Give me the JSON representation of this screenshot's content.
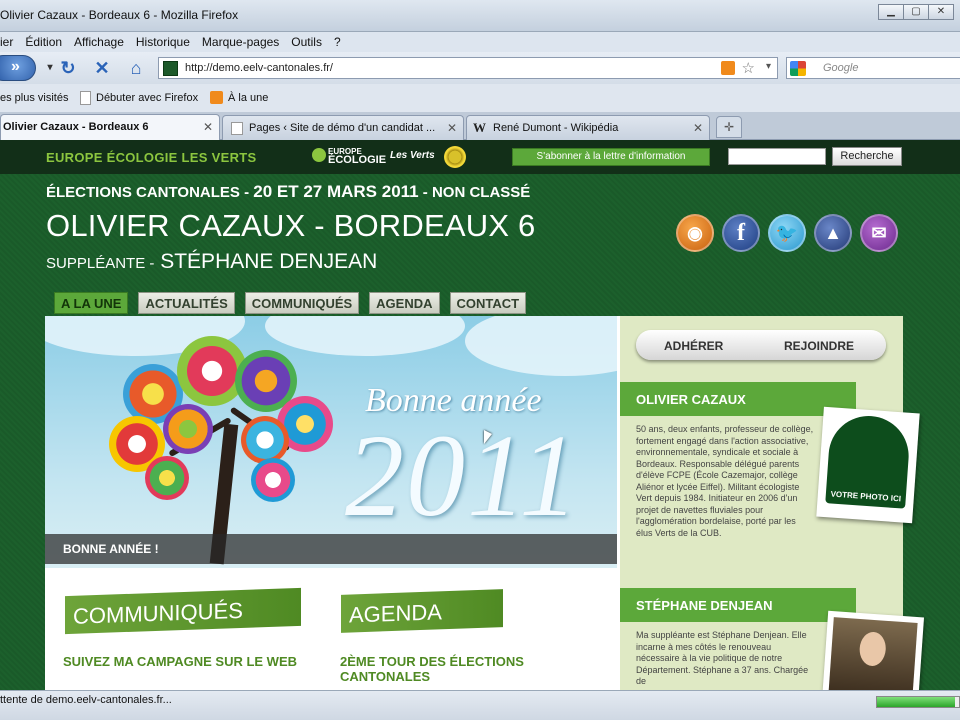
{
  "window": {
    "title": "Olivier Cazaux - Bordeaux 6 - Mozilla Firefox"
  },
  "menu": [
    "ier",
    "Édition",
    "Affichage",
    "Historique",
    "Marque-pages",
    "Outils",
    "?"
  ],
  "nav": {
    "url": "http://demo.eelv-cantonales.fr/",
    "search_placeholder": "Google"
  },
  "bookmarks": [
    "es plus visités",
    "Débuter avec Firefox",
    "À la une"
  ],
  "tabs": [
    {
      "label": "Olivier Cazaux - Bordeaux 6",
      "active": true
    },
    {
      "label": "Pages ‹ Site de démo d'un candidat ...",
      "active": false
    },
    {
      "label": "René Dumont - Wikipédia",
      "active": false
    }
  ],
  "site": {
    "brand": "EUROPE ÉCOLOGIE LES VERTS",
    "logo_ee": [
      "EUROPE",
      "ÉCOLOGIE"
    ],
    "logo_verts": "Les Verts",
    "subscribe": "S'abonner à la lettre d'information",
    "search_button": "Recherche",
    "election_prefix": "ÉLECTIONS CANTONALES -",
    "election_dates": "20 ET 27 MARS 2011",
    "election_suffix": "- NON CLASSÉ",
    "candidate": "OLIVIER CAZAUX - BORDEAUX 6",
    "substitute_prefix": "SUPPLÉANTE -",
    "substitute_name": "STÉPHANE DENJEAN",
    "menu": [
      "A LA UNE",
      "ACTUALITÉS",
      "COMMUNIQUÉS",
      "AGENDA",
      "CONTACT"
    ],
    "hero": {
      "greeting": "Bonne année",
      "year": "2011",
      "caption": "BONNE ANNÉE !"
    },
    "columns": [
      {
        "title": "COMMUNIQUÉS",
        "link": "SUIVEZ MA CAMPAGNE SUR LE WEB"
      },
      {
        "title": "AGENDA",
        "link": "2ÈME TOUR DES ÉLECTIONS CANTONALES"
      }
    ],
    "sidebar": {
      "join": "ADHÉRER",
      "rejoin": "REJOINDRE",
      "person1": "OLIVIER CAZAUX",
      "bio1": "50 ans, deux enfants, professeur de collège, fortement engagé dans l'action associative, environnementale, syndicale et sociale à Bordeaux. Responsable délégué parents d'élève FCPE (École Cazemajor, collège Aliénor et lycée Eiffel). Militant écologiste Vert depuis 1984. Initiateur en 2006 d'un projet de navettes fluviales pour l'agglomération bordelaise, porté par les élus Verts de la CUB.",
      "photo_label": "VOTRE PHOTO ICI",
      "person2": "STÉPHANE DENJEAN",
      "bio2": "Ma suppléante est Stéphane Denjean. Elle incarne à mes côtés le renouveau nécessaire à la vie politique de notre Département. Stéphane a 37 ans. Chargée de"
    }
  },
  "status": {
    "text": "ttente de demo.eelv-cantonales.fr...",
    "progress": 0.95
  },
  "colors": {
    "eelv_green": "#1c602c",
    "accent_green": "#5ca83a",
    "dark_strip": "#122f18"
  }
}
